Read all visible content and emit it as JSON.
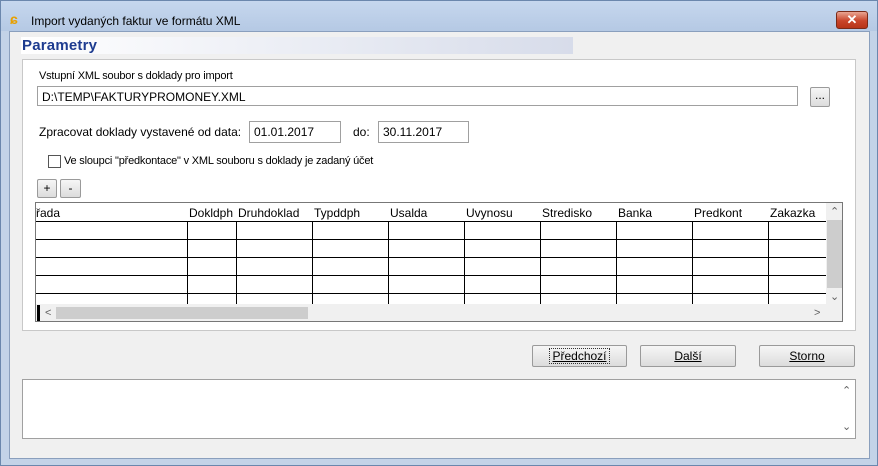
{
  "window": {
    "title": "Import vydaných faktur ve formátu XML",
    "close_symbol": "✕"
  },
  "section": {
    "title": "Parametry"
  },
  "file": {
    "label": "Vstupní XML soubor s doklady pro import",
    "value": "D:\\TEMP\\FAKTURYPROMONEY.XML",
    "browse_label": "..."
  },
  "date_range": {
    "label": "Zpracovat doklady vystavené od data:",
    "from_value": "01.01.2017",
    "to_label": "do:",
    "to_value": "30.11.2017"
  },
  "predkontace": {
    "label": "Ve sloupci \"předkontace\" v XML souboru s doklady je zadaný účet",
    "checked": false
  },
  "grid_toolbar": {
    "add_label": "+",
    "remove_label": "-"
  },
  "grid": {
    "columns": [
      "řada",
      "Dokldph",
      "Druhdoklad",
      "Typddph",
      "Usalda",
      "Uvynosu",
      "Stredisko",
      "Banka",
      "Predkont",
      "Zakazka"
    ]
  },
  "buttons": {
    "prev_label": "Předchozí",
    "next_label": "Další",
    "cancel_label": "Storno"
  }
}
